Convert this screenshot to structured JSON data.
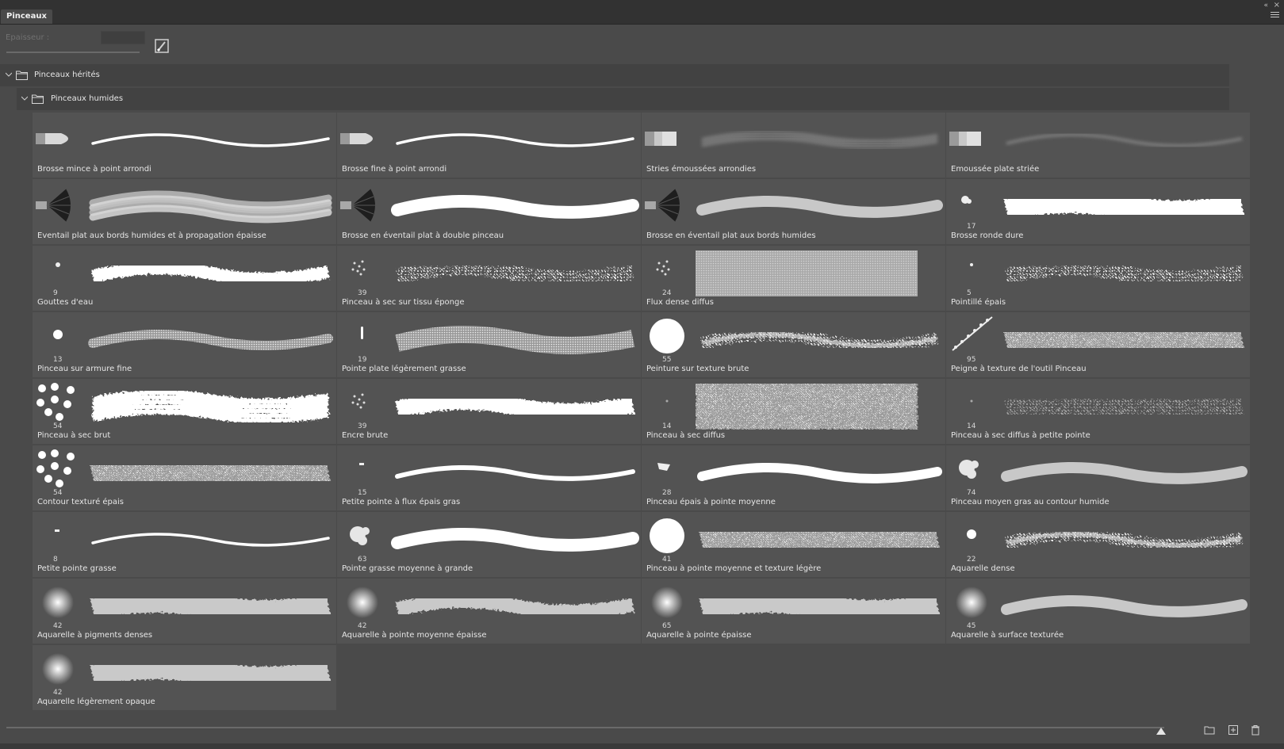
{
  "panel": {
    "tab_label": "Pinceaux",
    "size_label": "Epaisseur :"
  },
  "groups": {
    "parent": "Pinceaux hérités",
    "child": "Pinceaux humides"
  },
  "brushes": [
    {
      "name": "Brosse mince à point arrondi",
      "size": "",
      "tip": "round-brush",
      "stroke": "thin"
    },
    {
      "name": "Brosse fine à point arrondi",
      "size": "",
      "tip": "round-brush",
      "stroke": "thin"
    },
    {
      "name": "Stries émoussées arrondies",
      "size": "",
      "tip": "flat-brush",
      "stroke": "streaks"
    },
    {
      "name": "Emoussée plate striée",
      "size": "",
      "tip": "flat-brush",
      "stroke": "faint"
    },
    {
      "name": "Eventail plat aux bords humides et à propagation épaisse",
      "size": "",
      "tip": "fan",
      "stroke": "wide-multi"
    },
    {
      "name": "Brosse en éventail plat à double pinceau",
      "size": "",
      "tip": "fan",
      "stroke": "thick-white"
    },
    {
      "name": "Brosse en éventail plat aux bords humides",
      "size": "",
      "tip": "fan",
      "stroke": "thick-gray"
    },
    {
      "name": "Brosse ronde dure",
      "size": "17",
      "tip": "splat-small",
      "stroke": "rough-wide"
    },
    {
      "name": "Gouttes d'eau",
      "size": "9",
      "tip": "dot-small",
      "stroke": "blobby"
    },
    {
      "name": "Pinceau à sec sur tissu éponge",
      "size": "39",
      "tip": "scatter",
      "stroke": "dotted"
    },
    {
      "name": "Flux dense diffus",
      "size": "24",
      "tip": "scatter",
      "stroke": "block"
    },
    {
      "name": "Pointillé épais",
      "size": "5",
      "tip": "dot-tiny",
      "stroke": "dotted"
    },
    {
      "name": "Pinceau sur armure fine",
      "size": "13",
      "tip": "dot-mid",
      "stroke": "textured"
    },
    {
      "name": "Pointe plate légèrement grasse",
      "size": "19",
      "tip": "bar",
      "stroke": "textured-wide"
    },
    {
      "name": "Peinture sur texture brute",
      "size": "55",
      "tip": "circle-big",
      "stroke": "rough"
    },
    {
      "name": "Peigne à texture de l'outil Pinceau",
      "size": "95",
      "tip": "comb",
      "stroke": "comb-wide"
    },
    {
      "name": "Pinceau à sec brut",
      "size": "54",
      "tip": "dots-cluster",
      "stroke": "dry-multi"
    },
    {
      "name": "Encre brute",
      "size": "39",
      "tip": "scatter",
      "stroke": "ink"
    },
    {
      "name": "Pinceau à sec diffus",
      "size": "14",
      "tip": "dot-faint",
      "stroke": "block-noise"
    },
    {
      "name": "Pinceau à sec diffus à petite pointe",
      "size": "14",
      "tip": "dot-faint",
      "stroke": "sparkle"
    },
    {
      "name": "Contour texturé épais",
      "size": "54",
      "tip": "dots-cluster",
      "stroke": "noise-wide"
    },
    {
      "name": "Petite pointe à flux épais gras",
      "size": "15",
      "tip": "speck",
      "stroke": "medium"
    },
    {
      "name": "Pinceau épais à pointe moyenne",
      "size": "28",
      "tip": "speck-big",
      "stroke": "medium-thick"
    },
    {
      "name": "Pinceau moyen gras au contour humide",
      "size": "74",
      "tip": "splat-big",
      "stroke": "thick-gray"
    },
    {
      "name": "Petite pointe grasse",
      "size": "8",
      "tip": "speck",
      "stroke": "thin"
    },
    {
      "name": "Pointe grasse moyenne à grande",
      "size": "63",
      "tip": "splat-big",
      "stroke": "thick-white"
    },
    {
      "name": "Pinceau à pointe moyenne et texture légère",
      "size": "41",
      "tip": "circle-big",
      "stroke": "noise-wide"
    },
    {
      "name": "Aquarelle dense",
      "size": "22",
      "tip": "dot-mid",
      "stroke": "rough"
    },
    {
      "name": "Aquarelle à pigments denses",
      "size": "42",
      "tip": "soft",
      "stroke": "soft-wide"
    },
    {
      "name": "Aquarelle à pointe moyenne épaisse",
      "size": "42",
      "tip": "soft",
      "stroke": "soft"
    },
    {
      "name": "Aquarelle à pointe épaisse",
      "size": "65",
      "tip": "soft",
      "stroke": "soft-wide"
    },
    {
      "name": "Aquarelle à surface texturée",
      "size": "45",
      "tip": "soft",
      "stroke": "thick-gray"
    },
    {
      "name": "Aquarelle légèrement opaque",
      "size": "42",
      "tip": "soft",
      "stroke": "soft-wide"
    }
  ]
}
